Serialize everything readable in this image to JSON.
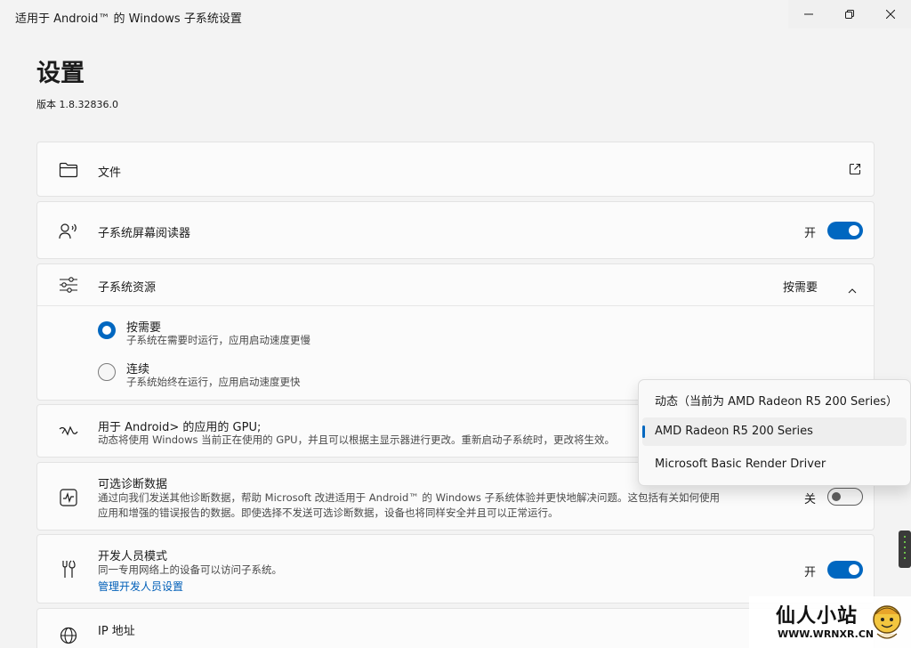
{
  "window": {
    "title": "适用于 Android™ 的 Windows 子系统设置",
    "controls": {
      "minimize": "minimize-icon",
      "maximize": "restore-icon",
      "close": "close-icon"
    }
  },
  "page": {
    "title": "设置",
    "version": "版本 1.8.32836.0"
  },
  "cards": {
    "files": {
      "label": "文件",
      "icon": "folder-icon",
      "action_icon": "open-external-icon"
    },
    "screen_reader": {
      "label": "子系统屏幕阅读器",
      "state_text": "开",
      "toggle_on": true,
      "icon": "speech-icon"
    },
    "resources": {
      "label": "子系统资源",
      "value": "按需要",
      "icon": "sliders-icon",
      "expanded": true,
      "options": [
        {
          "label": "按需要",
          "desc": "子系统在需要时运行，应用启动速度更慢",
          "checked": true
        },
        {
          "label": "连续",
          "desc": "子系统始终在运行，应用启动速度更快",
          "checked": false
        }
      ]
    },
    "gpu": {
      "label": "用于 Android> 的应用的 GPU;",
      "desc": "动态将使用 Windows 当前正在使用的 GPU，并且可以根据主显示器进行更改。重新启动子系统时，更改将生效。",
      "icon": "gpu-icon"
    },
    "diagnostics": {
      "label": "可选诊断数据",
      "desc_line1": "通过向我们发送其他诊断数据，帮助 Microsoft 改进适用于 Android™ 的 Windows 子系统体验并更快地解决问题。这包括有关如何使用",
      "desc_line2": "应用和增强的错误报告的数据。即使选择不发送可选诊断数据，设备也将同样安全并且可以正常运行。",
      "state_text": "关",
      "toggle_on": false,
      "icon": "activity-icon"
    },
    "developer": {
      "label": "开发人员模式",
      "desc": "同一专用网络上的设备可以访问子系统。",
      "link": "管理开发人员设置",
      "state_text": "开",
      "toggle_on": true,
      "icon": "tools-icon"
    },
    "ip": {
      "label": "IP 地址",
      "icon": "globe-icon"
    }
  },
  "gpu_dropdown": {
    "items": [
      {
        "label": "动态（当前为 AMD Radeon R5 200 Series）",
        "selected": false
      },
      {
        "label": "AMD Radeon R5 200 Series",
        "selected": true
      },
      {
        "label": "Microsoft Basic Render Driver",
        "selected": false
      }
    ]
  },
  "watermark": {
    "title": "仙人小站",
    "subtitle": "WWW.WRNXR.CN"
  },
  "colors": {
    "accent": "#0067c0",
    "background": "#f3f3f3",
    "card": "#fbfbfb"
  }
}
